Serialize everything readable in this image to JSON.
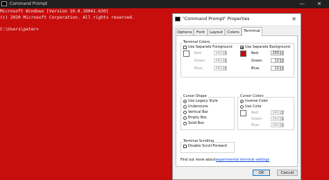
{
  "window": {
    "title": "Command Prompt",
    "close_glyph": "✕",
    "minimize_glyph": "—"
  },
  "console": {
    "lines": [
      "Microsoft Windows [Version 10.0.19041.630]",
      "(c) 2020 Microsoft Corporation. All rights reserved.",
      "",
      "C:\\Users\\peter>"
    ],
    "background": "#c80d0d"
  },
  "dialog": {
    "title": "\"Command Prompt\" Properties",
    "close_glyph": "✕",
    "tabs": [
      "Options",
      "Font",
      "Layout",
      "Colors",
      "Terminal"
    ],
    "active_tab": "Terminal",
    "terminal_colors": {
      "label": "Terminal Colors",
      "foreground": {
        "checkbox_label": "Use Separate Foreground",
        "checked": false,
        "red_label": "Red:",
        "red": "242",
        "green_label": "Green:",
        "green": "242",
        "blue_label": "Blue:",
        "blue": "242",
        "swatch_color": "#ffffff"
      },
      "background": {
        "checkbox_label": "Use Separate Background",
        "checked": true,
        "red_label": "Red:",
        "red": "200",
        "green_label": "Green:",
        "green": "12",
        "blue_label": "Blue:",
        "blue": "12",
        "swatch_color": "#c80c0c"
      }
    },
    "cursor_shape": {
      "label": "Cursor Shape",
      "options": [
        "Use Legacy Style",
        "Underscore",
        "Vertical Bar",
        "Empty Box",
        "Solid Box"
      ],
      "selected": "Use Legacy Style"
    },
    "cursor_colors": {
      "label": "Cursor Colors",
      "options": [
        "Inverse Color",
        "Use Color"
      ],
      "selected": "Inverse Color",
      "red_label": "Red:",
      "red": "242",
      "green_label": "Green:",
      "green": "242",
      "blue_label": "Blue:",
      "blue": "242"
    },
    "terminal_scrolling": {
      "label": "Terminal Scrolling",
      "checkbox_label": "Disable Scroll-Forward",
      "checked": false
    },
    "footer_text": "Find out more about",
    "footer_link": "experimental terminal settings",
    "ok_label": "OK",
    "cancel_label": "Cancel"
  }
}
